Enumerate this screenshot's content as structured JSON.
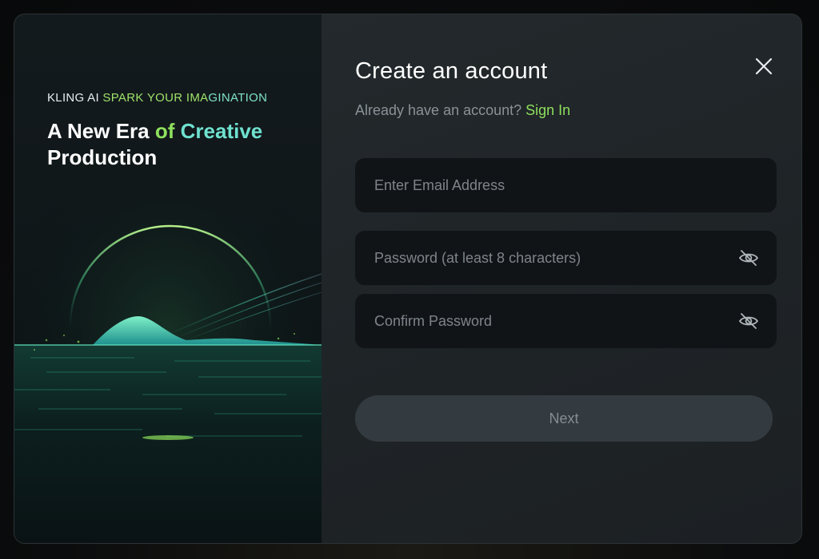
{
  "brand": {
    "tagline_prefix": "KLING AI ",
    "tagline_accent": "SPARK YOUR IMA",
    "tagline_accent2": "GINATION",
    "headline_part1": "A New Era ",
    "headline_part2": "of ",
    "headline_part3": "Creative",
    "headline_part4": "Production"
  },
  "form": {
    "title": "Create an account",
    "subtitle_text": "Already have an account? ",
    "signin_label": "Sign In",
    "email_placeholder": "Enter Email Address",
    "password_placeholder": "Password (at least 8 characters)",
    "confirm_placeholder": "Confirm Password",
    "next_label": "Next"
  },
  "icons": {
    "close": "close-icon",
    "password_toggle": "eye-off-icon",
    "confirm_toggle": "eye-off-icon"
  },
  "colors": {
    "accent_green": "#8ee05c",
    "accent_teal": "#6fe1cf",
    "button_disabled_bg": "#343b40",
    "input_bg": "#111417"
  }
}
